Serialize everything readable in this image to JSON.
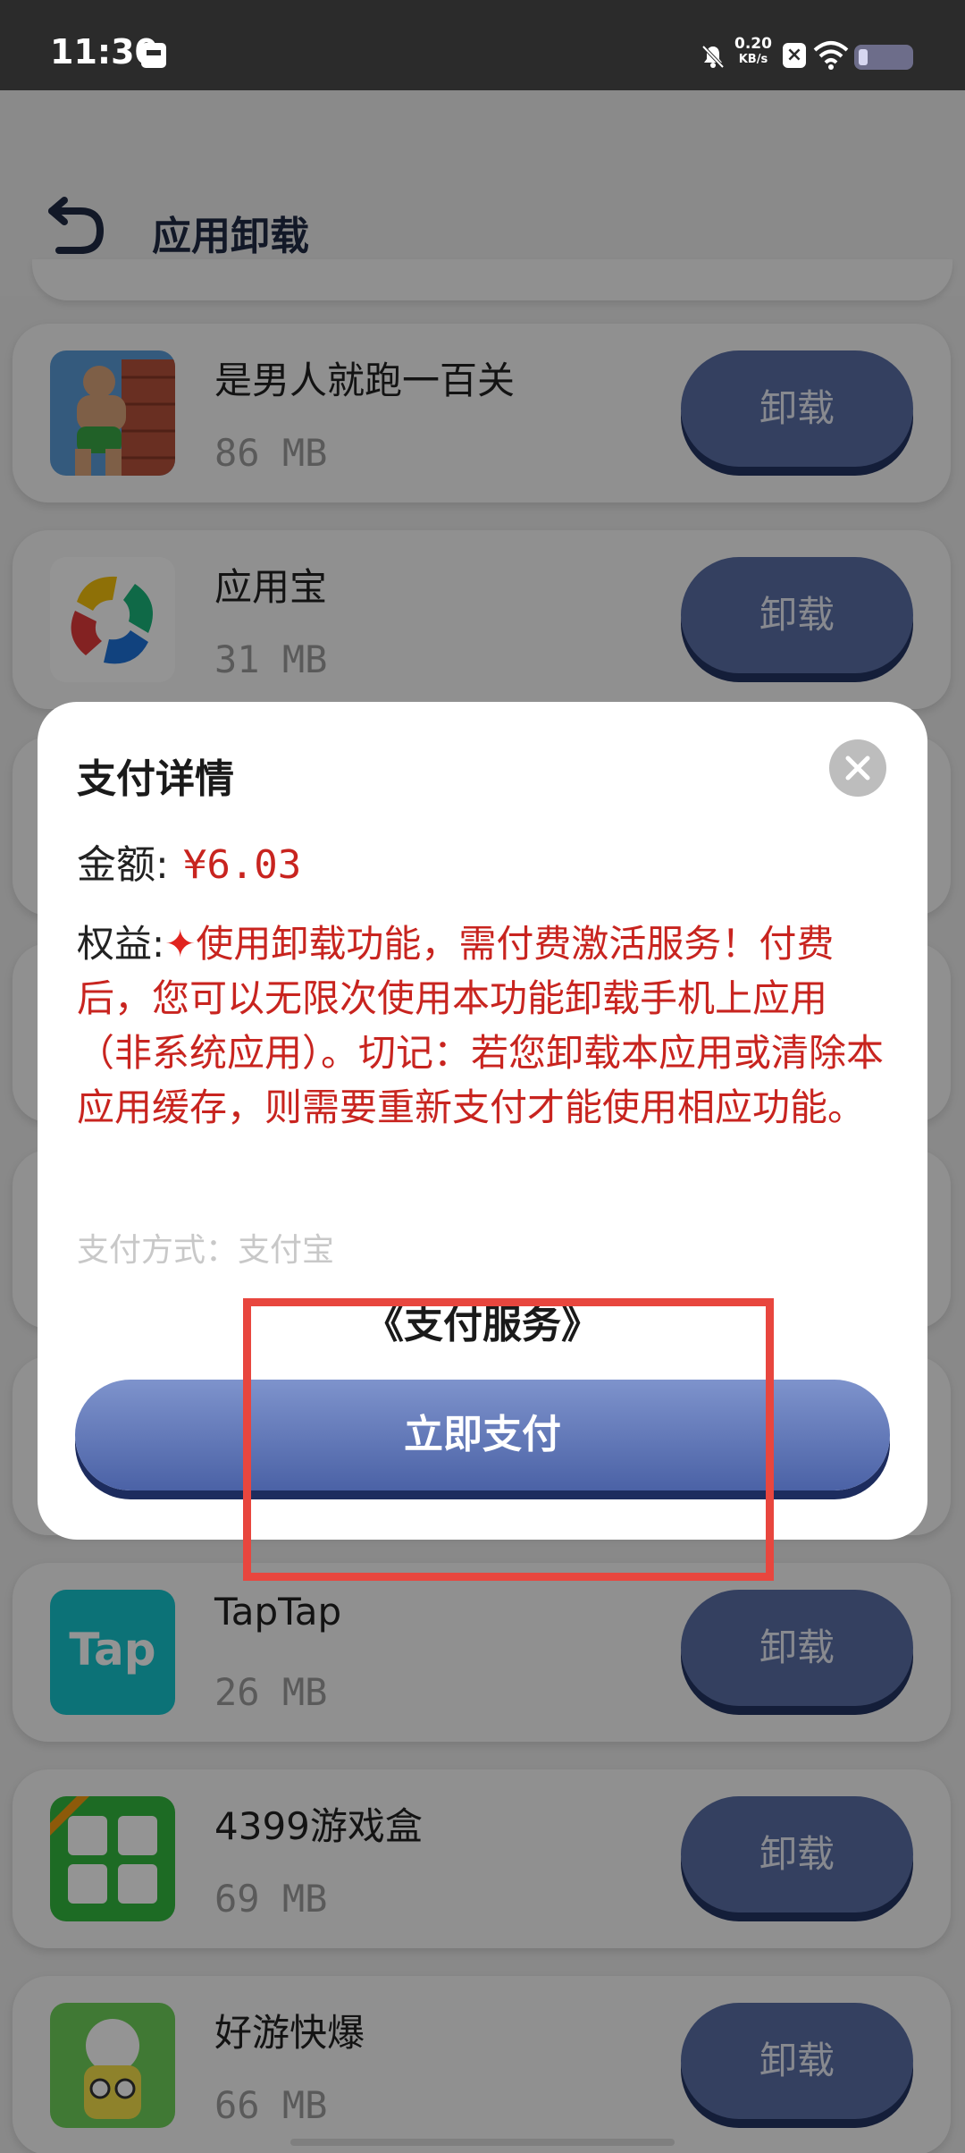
{
  "status_bar": {
    "time": "11:30",
    "network_speed_value": "0.20",
    "network_speed_unit": "KB/s",
    "icons": [
      "sim-icon",
      "mute-icon",
      "close-notify-icon",
      "wifi-icon",
      "battery-icon"
    ]
  },
  "header": {
    "title": "应用卸载"
  },
  "apps": [
    {
      "name": "是男人就跑一百关",
      "size": "86 MB",
      "button": "卸载"
    },
    {
      "name": "应用宝",
      "size": "31 MB",
      "button": "卸载"
    },
    {
      "name": "TapTap",
      "size": "26 MB",
      "button": "卸载"
    },
    {
      "name": "4399游戏盒",
      "size": "69 MB",
      "button": "卸载"
    },
    {
      "name": "好游快爆",
      "size": "66 MB",
      "button": "卸载"
    }
  ],
  "dialog": {
    "title": "支付详情",
    "amount_label": "金额:",
    "amount_value": "¥6.03",
    "benefit_label": "权益:",
    "benefit_star": "✦",
    "benefit_text": "使用卸载功能，需付费激活服务！付费后，您可以无限次使用本功能卸载手机上应用（非系统应用）。切记：若您卸载本应用或清除本应用缓存，则需要重新支付才能使用相应功能。",
    "payment_method": "支付方式：支付宝",
    "service_link": "《支付服务》",
    "pay_button": "立即支付"
  },
  "colors": {
    "accent": "#4b62a6",
    "price_red": "#c8241f",
    "annotation_red": "#e8463e"
  }
}
